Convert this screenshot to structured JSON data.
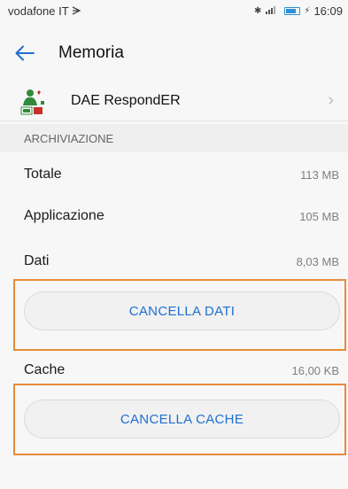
{
  "status_bar": {
    "carrier": "vodafone IT",
    "time": "16:09",
    "battery_color": "#2f8fd8"
  },
  "header": {
    "title": "Memoria",
    "back_icon": "arrow-left-icon"
  },
  "app": {
    "name": "DAE RespondER",
    "icon": "dae-responder-app-icon"
  },
  "section": {
    "title": "ARCHIVIAZIONE"
  },
  "storage": {
    "total_label": "Totale",
    "total_value": "113 MB",
    "app_label": "Applicazione",
    "app_value": "105 MB",
    "data_label": "Dati",
    "data_value": "8,03 MB",
    "cache_label": "Cache",
    "cache_value": "16,00 KB"
  },
  "buttons": {
    "clear_data": "CANCELLA DATI",
    "clear_cache": "CANCELLA CACHE"
  },
  "colors": {
    "accent": "#1f6fd1",
    "highlight": "#e88b3a"
  }
}
